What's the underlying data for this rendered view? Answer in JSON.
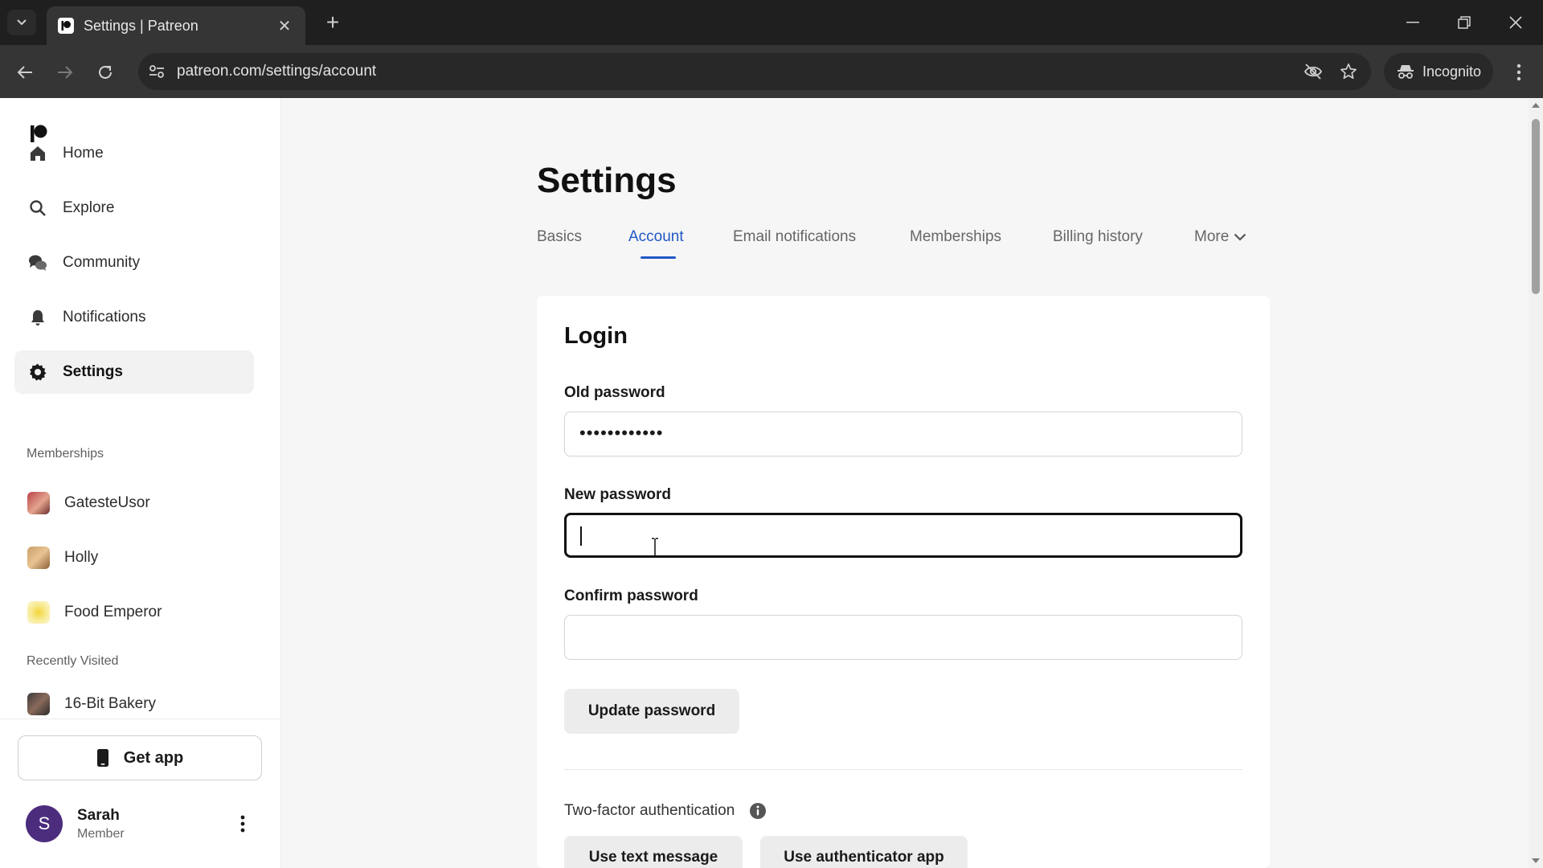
{
  "browser": {
    "tab_title": "Settings | Patreon",
    "url": "patreon.com/settings/account",
    "incognito_label": "Incognito"
  },
  "sidebar": {
    "nav": [
      {
        "label": "Home",
        "icon": "home-icon"
      },
      {
        "label": "Explore",
        "icon": "search-icon"
      },
      {
        "label": "Community",
        "icon": "chat-icon"
      },
      {
        "label": "Notifications",
        "icon": "bell-icon"
      },
      {
        "label": "Settings",
        "icon": "gear-icon",
        "active": true
      }
    ],
    "memberships_label": "Memberships",
    "memberships": [
      {
        "label": "GatesteUsor"
      },
      {
        "label": "Holly"
      },
      {
        "label": "Food Emperor"
      }
    ],
    "recent_label": "Recently Visited",
    "recent": [
      {
        "label": "16-Bit Bakery"
      }
    ],
    "get_app_label": "Get app",
    "user": {
      "initial": "S",
      "name": "Sarah",
      "role": "Member"
    }
  },
  "main": {
    "title": "Settings",
    "tabs": [
      {
        "label": "Basics"
      },
      {
        "label": "Account",
        "active": true
      },
      {
        "label": "Email notifications"
      },
      {
        "label": "Memberships"
      },
      {
        "label": "Billing history"
      },
      {
        "label": "More"
      }
    ],
    "login": {
      "heading": "Login",
      "old_password_label": "Old password",
      "old_password_value": "••••••••••••",
      "new_password_label": "New password",
      "new_password_value": "",
      "confirm_password_label": "Confirm password",
      "confirm_password_value": "",
      "update_button": "Update password"
    },
    "two_factor": {
      "label": "Two-factor authentication",
      "text_message_button": "Use text message",
      "authenticator_button": "Use authenticator app"
    }
  },
  "colors": {
    "accent": "#1f57c5",
    "avatar_bg": "#4b2c7d"
  }
}
